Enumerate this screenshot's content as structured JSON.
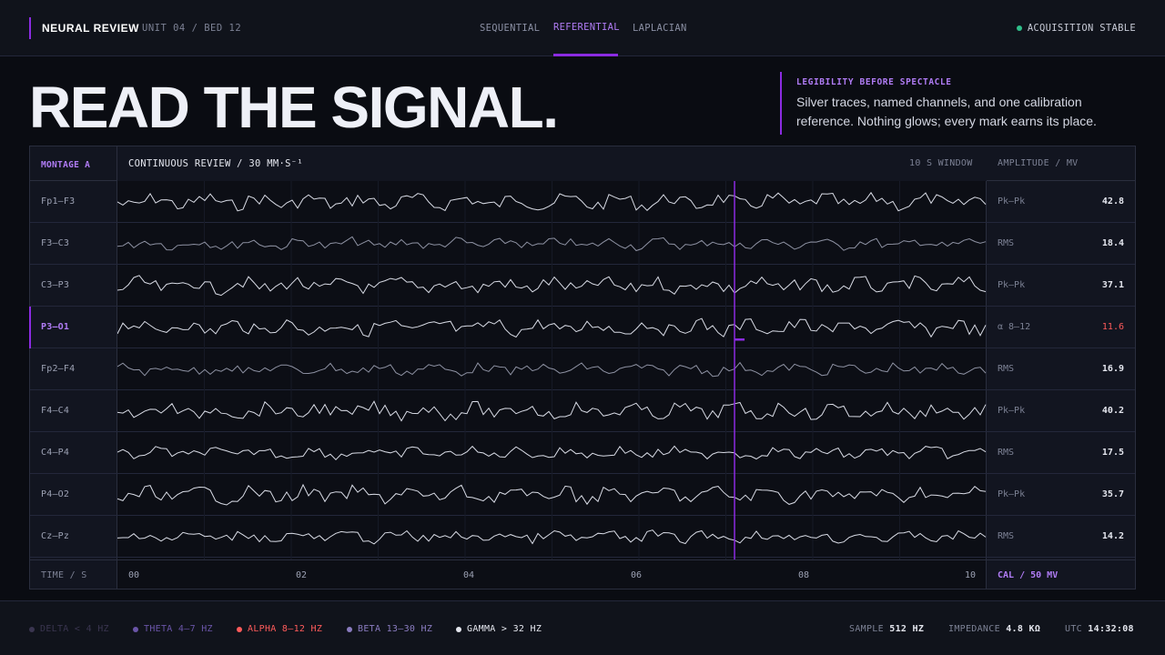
{
  "brand": {
    "title": "NEURAL REVIEW",
    "subtitle": "UNIT 04 / BED 12"
  },
  "tabs": [
    {
      "label": "SEQUENTIAL",
      "active": false
    },
    {
      "label": "REFERENTIAL",
      "active": true
    },
    {
      "label": "LAPLACIAN",
      "active": false
    }
  ],
  "status": {
    "label": "ACQUISITION STABLE",
    "color": "#2fbf8a"
  },
  "hero": {
    "title": "READ THE SIGNAL.",
    "kicker": "LEGIBILITY BEFORE SPECTACLE",
    "body": "Silver traces, named channels, and one calibration reference. Nothing glows; every mark earns its place."
  },
  "panel": {
    "montage": "MONTAGE A",
    "mode": "CONTINUOUS REVIEW / 30 MM·S⁻¹",
    "window": "10 S WINDOW",
    "amplitude_header": "AMPLITUDE / MV",
    "time_label": "TIME / S",
    "cal": "CAL / 50 MV",
    "time_ticks": [
      "00",
      "02",
      "04",
      "06",
      "08",
      "10"
    ],
    "cursor_time_s": 7.1,
    "channels": [
      {
        "name": "Fp1–F3",
        "metric": "Pk–Pk",
        "value": "42.8",
        "selected": false,
        "alert": false
      },
      {
        "name": "F3–C3",
        "metric": "RMS",
        "value": "18.4",
        "selected": false,
        "alert": false
      },
      {
        "name": "C3–P3",
        "metric": "Pk–Pk",
        "value": "37.1",
        "selected": false,
        "alert": false
      },
      {
        "name": "P3–O1",
        "metric": "α 8–12",
        "value": "11.6",
        "selected": true,
        "alert": true
      },
      {
        "name": "Fp2–F4",
        "metric": "RMS",
        "value": "16.9",
        "selected": false,
        "alert": false
      },
      {
        "name": "F4–C4",
        "metric": "Pk–Pk",
        "value": "40.2",
        "selected": false,
        "alert": false
      },
      {
        "name": "C4–P4",
        "metric": "RMS",
        "value": "17.5",
        "selected": false,
        "alert": false
      },
      {
        "name": "P4–O2",
        "metric": "Pk–Pk",
        "value": "35.7",
        "selected": false,
        "alert": false
      },
      {
        "name": "Cz–Pz",
        "metric": "RMS",
        "value": "14.2",
        "selected": false,
        "alert": false
      }
    ]
  },
  "bands": [
    {
      "label": "DELTA < 4 HZ",
      "color": "#3a3550"
    },
    {
      "label": "THETA 4–7 HZ",
      "color": "#6a55a8"
    },
    {
      "label": "ALPHA 8–12 HZ",
      "color": "#ff5b5b"
    },
    {
      "label": "BETA 13–30 HZ",
      "color": "#8a7cc0"
    },
    {
      "label": "GAMMA > 32 HZ",
      "color": "#e4e6ee"
    }
  ],
  "stats": {
    "sample_label": "SAMPLE",
    "sample_value": "512 HZ",
    "impedance_label": "IMPEDANCE",
    "impedance_value": "4.8 KΩ",
    "utc_label": "UTC",
    "utc_value": "14:32:08"
  },
  "colors": {
    "accent": "#8b2be2",
    "accent_text": "#b07cf5",
    "alert": "#ff5b5b",
    "trace": "#d9dce6"
  }
}
